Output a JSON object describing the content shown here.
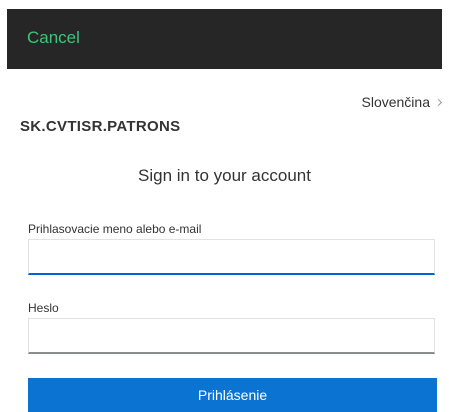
{
  "topbar": {
    "cancel_label": "Cancel",
    "background_color": "#262626",
    "accent_color": "#3ec47a"
  },
  "language": {
    "selected": "Slovenčina"
  },
  "realm": {
    "name": "SK.CVTISR.PATRONS"
  },
  "login": {
    "heading": "Sign in to your account",
    "username_label": "Prihlasovacie meno alebo e-mail",
    "username_value": "",
    "password_label": "Heslo",
    "password_value": "",
    "submit_label": "Prihlásenie",
    "primary_color": "#0b74d3",
    "focus_color": "#0066cc"
  }
}
